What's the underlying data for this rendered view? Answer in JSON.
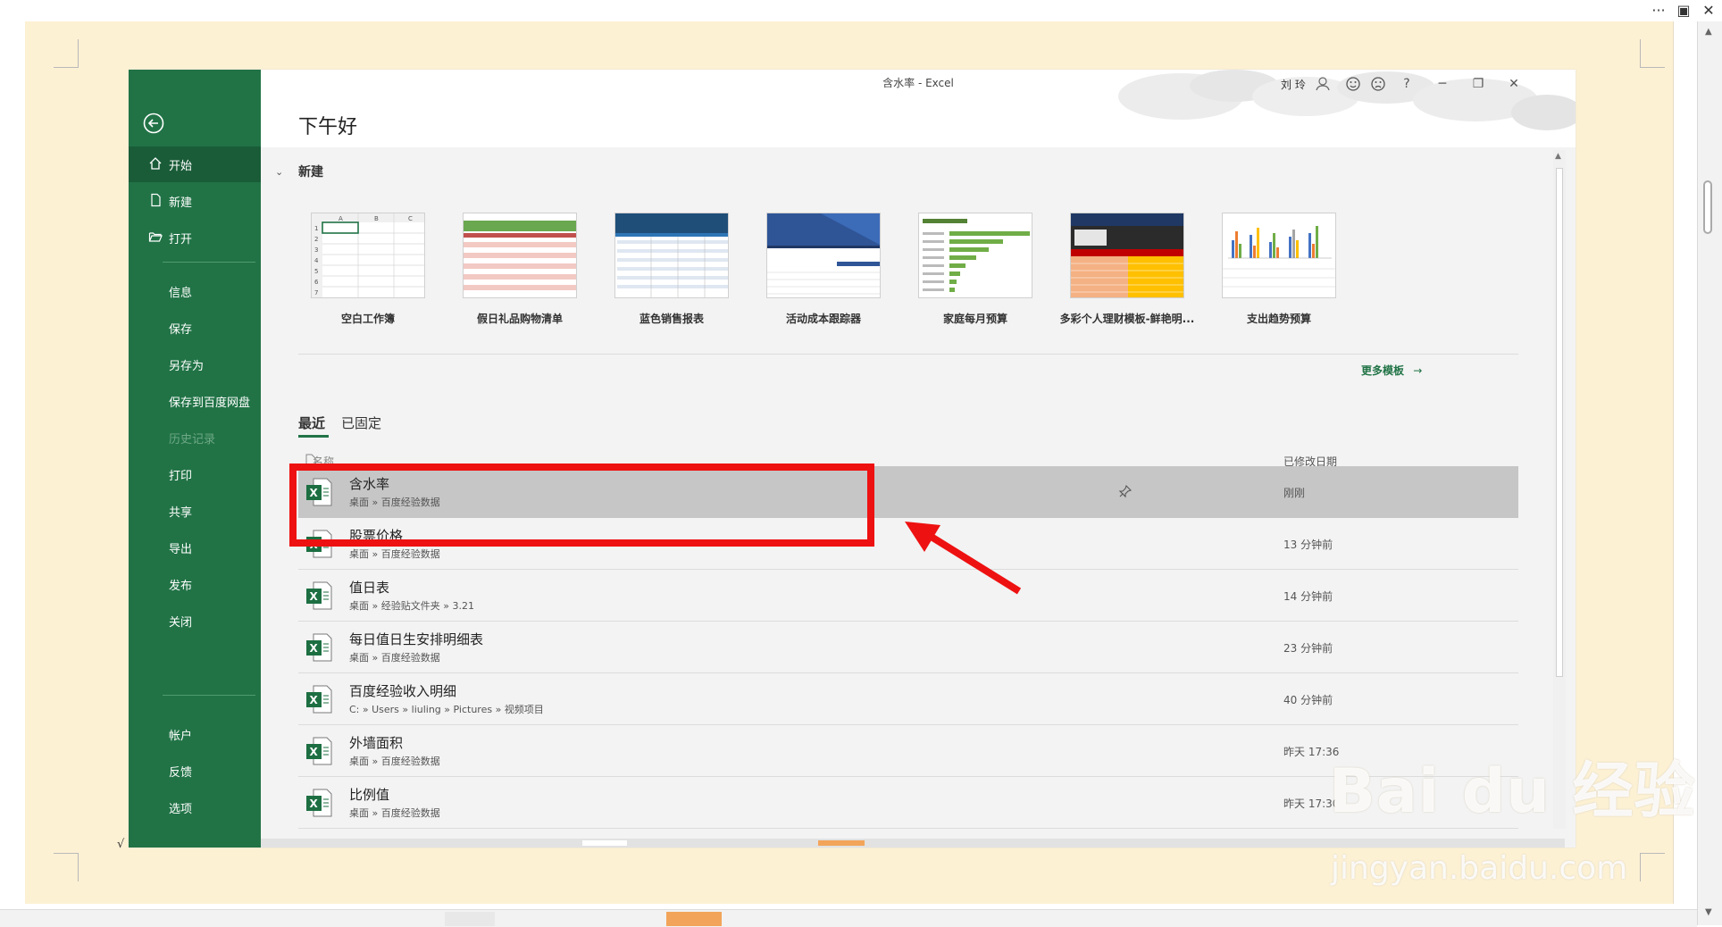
{
  "topbar": {
    "more": "···",
    "restore": "▣",
    "close": "✕"
  },
  "window": {
    "title": "含水率 - Excel",
    "user": "刘 玲",
    "greeting": "下午好"
  },
  "header_buttons": {
    "help": "?",
    "minimize": "─",
    "restore": "❐",
    "close": "✕"
  },
  "sidebar": {
    "items": [
      {
        "label": "开始"
      },
      {
        "label": "新建"
      },
      {
        "label": "打开"
      },
      {
        "label": "信息"
      },
      {
        "label": "保存"
      },
      {
        "label": "另存为"
      },
      {
        "label": "保存到百度网盘"
      },
      {
        "label": "历史记录"
      },
      {
        "label": "打印"
      },
      {
        "label": "共享"
      },
      {
        "label": "导出"
      },
      {
        "label": "发布"
      },
      {
        "label": "关闭"
      },
      {
        "label": "帐户"
      },
      {
        "label": "反馈"
      },
      {
        "label": "选项"
      }
    ]
  },
  "new_section": {
    "title": "新建",
    "templates": [
      {
        "name": "空白工作簿"
      },
      {
        "name": "假日礼品购物清单"
      },
      {
        "name": "蓝色销售报表"
      },
      {
        "name": "活动成本跟踪器"
      },
      {
        "name": "家庭每月预算"
      },
      {
        "name": "多彩个人理财模板-鲜艳明..."
      },
      {
        "name": "支出趋势预算"
      }
    ],
    "more": "更多模板"
  },
  "recent": {
    "tabs": [
      {
        "label": "最近"
      },
      {
        "label": "已固定"
      }
    ],
    "col_name": "名称",
    "col_date": "已修改日期",
    "files": [
      {
        "name": "含水率",
        "path": "桌面 » 百度经验数据",
        "date": "刚刚"
      },
      {
        "name": "股票价格",
        "path": "桌面 » 百度经验数据",
        "date": "13 分钟前"
      },
      {
        "name": "值日表",
        "path": "桌面 » 经验贴文件夹 » 3.21",
        "date": "14 分钟前"
      },
      {
        "name": "每日值日生安排明细表",
        "path": "桌面 » 百度经验数据",
        "date": "23 分钟前"
      },
      {
        "name": "百度经验收入明细",
        "path": "C: » Users » liuling » Pictures » 视频项目",
        "date": "40 分钟前"
      },
      {
        "name": "外墙面积",
        "path": "桌面 » 百度经验数据",
        "date": "昨天 17:36"
      },
      {
        "name": "比例值",
        "path": "桌面 » 百度经验数据",
        "date": "昨天 17:30"
      }
    ]
  },
  "watermark": {
    "brand": "Bai du 经验",
    "url": "jingyan.baidu.com"
  },
  "colors": {
    "excel_green": "#217346",
    "highlight_red": "#ee1111"
  }
}
